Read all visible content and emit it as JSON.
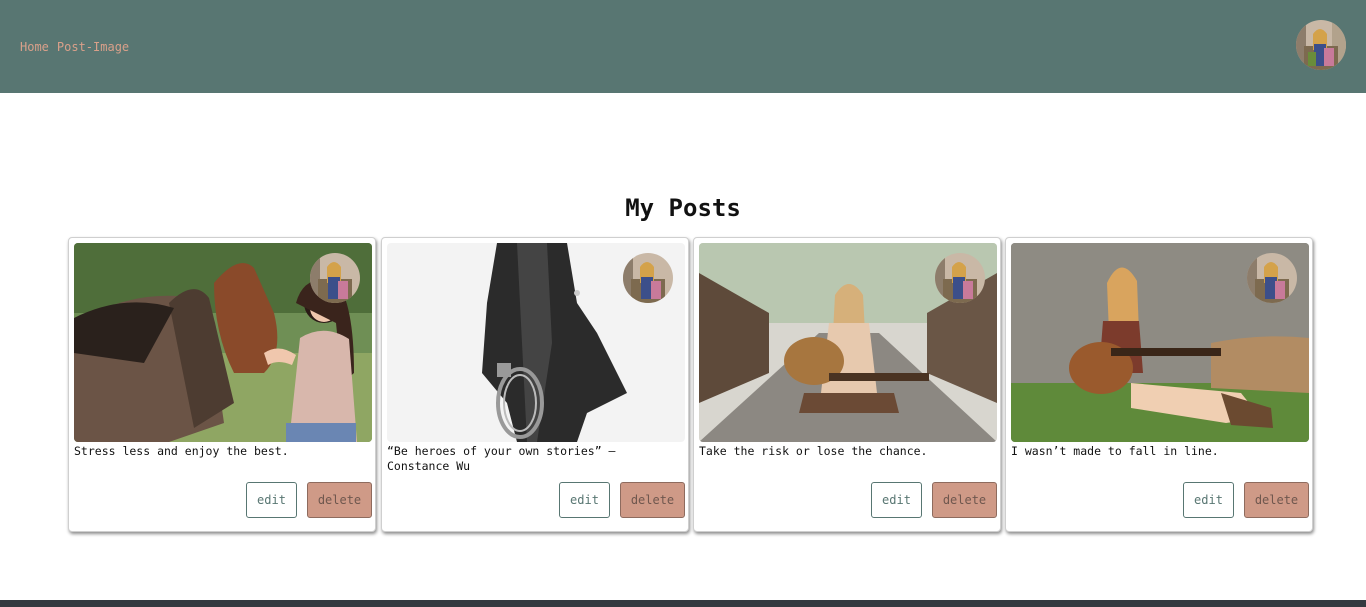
{
  "nav": {
    "links": [
      "Home",
      "Post-Image"
    ]
  },
  "page": {
    "title": "My Posts"
  },
  "posts": [
    {
      "caption": "Stress less and enjoy the best.",
      "edit_label": "edit",
      "delete_label": "delete"
    },
    {
      "caption": "“Be heroes of your own stories” – Constance Wu",
      "edit_label": "edit",
      "delete_label": "delete"
    },
    {
      "caption": "Take the risk or lose the chance.",
      "edit_label": "edit",
      "delete_label": "delete"
    },
    {
      "caption": "I wasn’t made to fall in line.",
      "edit_label": "edit",
      "delete_label": "delete"
    }
  ],
  "colors": {
    "header": "#587672",
    "nav_link": "#d9a08a",
    "delete_button": "#cf9a87",
    "footer": "#343a40"
  },
  "icons": {
    "profile_avatar": "avatar-image"
  }
}
